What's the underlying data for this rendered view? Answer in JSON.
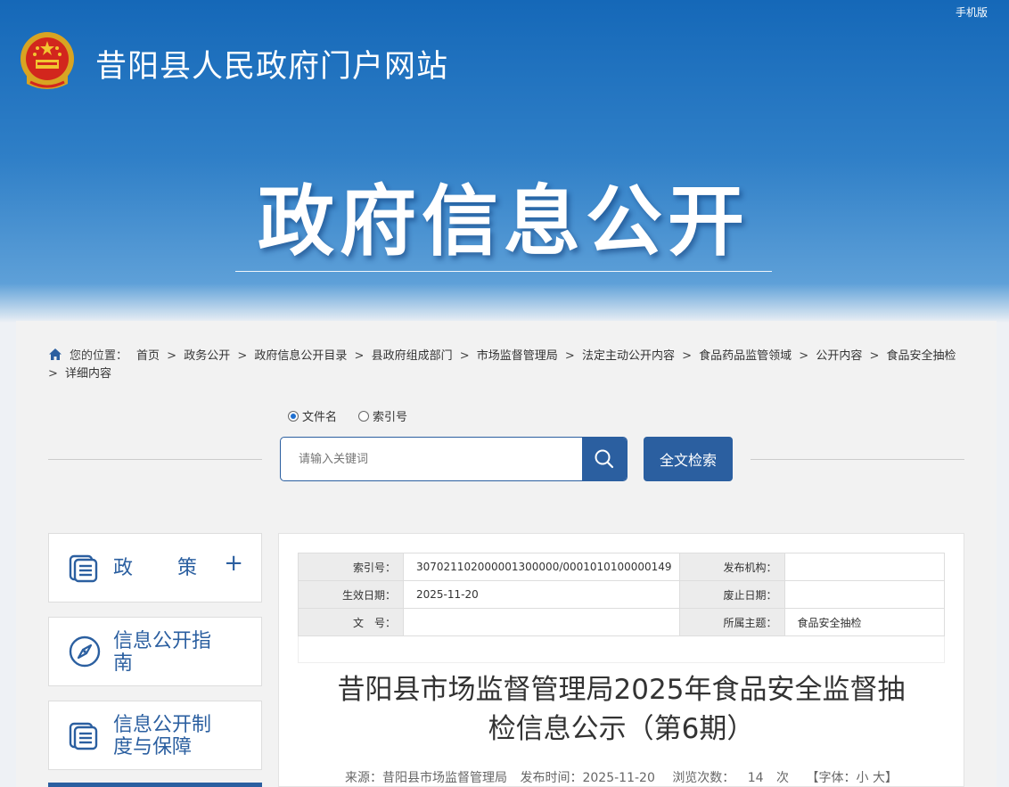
{
  "header": {
    "mobile_link": "手机版",
    "site_title": "昔阳县人民政府门户网站",
    "hero_title": "政府信息公开"
  },
  "breadcrumb": {
    "prefix": "您的位置：",
    "items": [
      "首页",
      "政务公开",
      "政府信息公开目录",
      "县政府组成部门",
      "市场监督管理局",
      "法定主动公开内容",
      "食品药品监管领域",
      "公开内容",
      "食品安全抽检",
      "详细内容"
    ]
  },
  "search": {
    "radio_options": [
      {
        "label": "文件名",
        "checked": true
      },
      {
        "label": "索引号",
        "checked": false
      }
    ],
    "placeholder": "请输入关键词",
    "fulltext_button": "全文检索"
  },
  "sidebar": {
    "items": [
      {
        "label": "政　　策",
        "icon": "document-list-icon",
        "expandable": true
      },
      {
        "label": "信息公开指南",
        "icon": "compass-icon"
      },
      {
        "label": "信息公开制度与保障",
        "icon": "document-list-icon"
      }
    ]
  },
  "meta_table": {
    "rows": [
      {
        "k1": "索引号：",
        "v1": "307021102000001300000/0001010100000149",
        "k2": "发布机构：",
        "v2": ""
      },
      {
        "k1": "生效日期：",
        "v1": "2025-11-20",
        "k2": "废止日期：",
        "v2": ""
      },
      {
        "k1": "文　号：",
        "v1": "",
        "k2": "所属主题：",
        "v2": "食品安全抽检"
      }
    ]
  },
  "article": {
    "title_line1": "昔阳县市场监督管理局2025年食品安全监督抽",
    "title_line2": "检信息公示（第6期）",
    "source_label": "来源：昔阳县市场监督管理局",
    "publish_label": "发布时间：2025-11-20",
    "views_label": "浏览次数：",
    "views_count": "14",
    "views_unit": "次",
    "font_label": "【字体：小 大】"
  },
  "colors": {
    "primary": "#2b5fa0",
    "banner_top": "#1568b8"
  }
}
